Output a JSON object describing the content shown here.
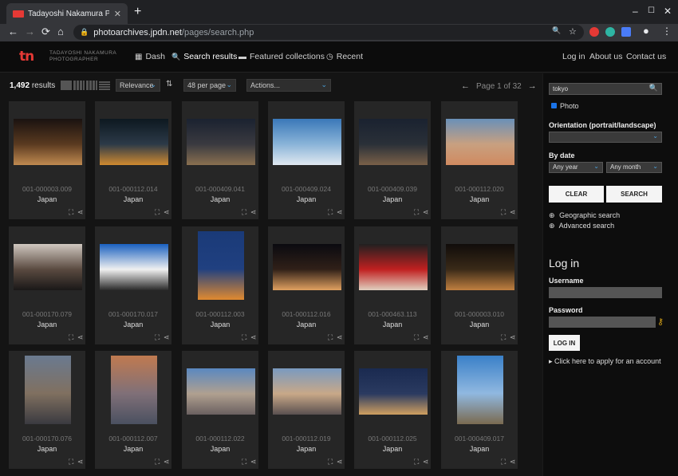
{
  "browser": {
    "tab_title": "Tadayoshi Nakamura Photograp",
    "tab_close": "✕",
    "new_tab": "+",
    "url_host": "photoarchives.jpdn.net",
    "url_path": "/pages/search.php",
    "minimize": "–",
    "maximize": "☐",
    "close": "✕",
    "back": "←",
    "forward": "→",
    "reload": "⟳",
    "home": "⌂",
    "lock": "🔒",
    "search_icon": "🔍",
    "star": "☆",
    "menu": "⋮",
    "ext_colors": [
      "#e53935",
      "#2eb5a3",
      "#4a7cf7"
    ],
    "profile": "●"
  },
  "site": {
    "logo_mark": "tn",
    "logo_line1": "TADAYOSHI NAKAMURA",
    "logo_line2": "PHOTOGRAPHER",
    "nav": [
      {
        "label": "Dash",
        "icon": "▦"
      },
      {
        "label": "Search results",
        "icon": "🔍"
      },
      {
        "label": "Featured collections",
        "icon": "▬"
      },
      {
        "label": "Recent",
        "icon": "◷"
      }
    ],
    "nav_right": [
      "Log in",
      "About us",
      "Contact us"
    ]
  },
  "results": {
    "count": "1,492",
    "count_suffix": "results",
    "sort": "Relevance",
    "sort_caret": "⌄",
    "sort_icon": "⇅",
    "per_page": "48 per page",
    "actions": "Actions...",
    "prev": "←",
    "page_label": "Page 1 of 32",
    "next": "→"
  },
  "photos": [
    {
      "id": "001-000003.009",
      "location": "Japan",
      "orientation": "landscape",
      "colors": [
        "#1a1210",
        "#5a3a20",
        "#c08a50"
      ]
    },
    {
      "id": "001-000112.014",
      "location": "Japan",
      "orientation": "landscape",
      "colors": [
        "#0d1820",
        "#2c3a48",
        "#d08a30"
      ]
    },
    {
      "id": "001-000409.041",
      "location": "Japan",
      "orientation": "landscape",
      "colors": [
        "#1a2230",
        "#3a3a40",
        "#8a7050"
      ]
    },
    {
      "id": "001-000409.024",
      "location": "Japan",
      "orientation": "landscape",
      "colors": [
        "#3a78b8",
        "#8ab4d8",
        "#e0e8f0"
      ]
    },
    {
      "id": "001-000409.039",
      "location": "Japan",
      "orientation": "landscape",
      "colors": [
        "#1a2230",
        "#2a3038",
        "#7a6048"
      ]
    },
    {
      "id": "001-000112.020",
      "location": "Japan",
      "orientation": "landscape",
      "colors": [
        "#6a90b8",
        "#c8a080",
        "#d08a60"
      ]
    },
    {
      "id": "001-000170.079",
      "location": "Japan",
      "orientation": "landscape",
      "colors": [
        "#d0c8c0",
        "#5a4a40",
        "#1a1818"
      ]
    },
    {
      "id": "001-000170.017",
      "location": "Japan",
      "orientation": "landscape",
      "colors": [
        "#1a60c0",
        "#f0f0f0",
        "#2a2a2a"
      ]
    },
    {
      "id": "001-000112.003",
      "location": "Japan",
      "orientation": "portrait",
      "colors": [
        "#1a3a78",
        "#204080",
        "#e08a30"
      ]
    },
    {
      "id": "001-000112.016",
      "location": "Japan",
      "orientation": "landscape",
      "colors": [
        "#0a0a10",
        "#302018",
        "#e0a060"
      ]
    },
    {
      "id": "001-000463.113",
      "location": "Japan",
      "orientation": "landscape",
      "colors": [
        "#202020",
        "#c02020",
        "#e0d0c0"
      ]
    },
    {
      "id": "001-000003.010",
      "location": "Japan",
      "orientation": "landscape",
      "colors": [
        "#100c0a",
        "#3a2a18",
        "#c08040"
      ]
    },
    {
      "id": "001-000170.076",
      "location": "Japan",
      "orientation": "portrait",
      "colors": [
        "#6a7a90",
        "#807060",
        "#3a3a40"
      ]
    },
    {
      "id": "001-000112.007",
      "location": "Japan",
      "orientation": "portrait",
      "colors": [
        "#c07a50",
        "#807078",
        "#4a5060"
      ]
    },
    {
      "id": "001-000112.022",
      "location": "Japan",
      "orientation": "landscape",
      "colors": [
        "#5a88c0",
        "#b0a090",
        "#6a6060"
      ]
    },
    {
      "id": "001-000112.019",
      "location": "Japan",
      "orientation": "landscape",
      "colors": [
        "#7a9ac0",
        "#c8a888",
        "#5a5050"
      ]
    },
    {
      "id": "001-000112.025",
      "location": "Japan",
      "orientation": "landscape",
      "colors": [
        "#1a2a50",
        "#2a3a60",
        "#d0a060"
      ]
    },
    {
      "id": "001-000409.017",
      "location": "Japan",
      "orientation": "portrait",
      "colors": [
        "#3a80c8",
        "#90b8e0",
        "#7a6a50"
      ]
    }
  ],
  "card_icons": {
    "expand": "⛶",
    "share": "⋖"
  },
  "sidebar": {
    "search_value": "tokyo",
    "search_icon": "🔍",
    "photo_label": "Photo",
    "orientation_label": "Orientation (portrait/landscape)",
    "orientation_value": "",
    "date_label": "By date",
    "year_value": "Any year",
    "month_value": "Any month",
    "caret": "⌄",
    "clear_label": "CLEAR",
    "search_label": "SEARCH",
    "geo_icon": "⊕",
    "geo_label": "Geographic search",
    "adv_icon": "⊕",
    "adv_label": "Advanced search",
    "login_title": "Log in",
    "username_label": "Username",
    "password_label": "Password",
    "key_icon": "⚷",
    "login_button": "LOG IN",
    "apply_arrow": "▸",
    "apply_label": "Click here to apply for an account"
  }
}
